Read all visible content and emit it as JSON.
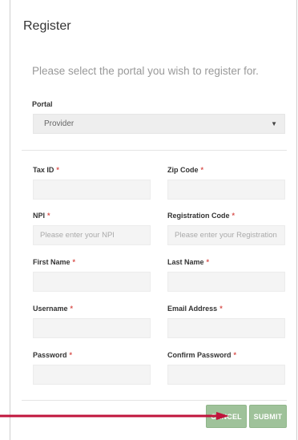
{
  "dialog": {
    "title": "Register",
    "subtitle": "Please select the portal you wish to register for."
  },
  "portal": {
    "label": "Portal",
    "selected": "Provider"
  },
  "required_marker": "*",
  "fields": {
    "tax_id": {
      "label": "Tax ID",
      "value": "",
      "placeholder": ""
    },
    "zip_code": {
      "label": "Zip Code",
      "value": "",
      "placeholder": ""
    },
    "npi": {
      "label": "NPI",
      "value": "",
      "placeholder": "Please enter your NPI"
    },
    "registration_code": {
      "label": "Registration Code",
      "value": "",
      "placeholder": "Please enter your Registration"
    },
    "first_name": {
      "label": "First Name",
      "value": "",
      "placeholder": ""
    },
    "last_name": {
      "label": "Last Name",
      "value": "",
      "placeholder": ""
    },
    "username": {
      "label": "Username",
      "value": "",
      "placeholder": ""
    },
    "email": {
      "label": "Email Address",
      "value": "",
      "placeholder": ""
    },
    "password": {
      "label": "Password",
      "value": "",
      "placeholder": ""
    },
    "confirm_password": {
      "label": "Confirm Password",
      "value": "",
      "placeholder": ""
    }
  },
  "buttons": {
    "cancel": "CANCEL",
    "submit": "SUBMIT"
  },
  "colors": {
    "required": "#d9534f",
    "button": "#9fc29a",
    "arrow": "#c0143c"
  },
  "icons": {
    "select_caret": "▼"
  }
}
